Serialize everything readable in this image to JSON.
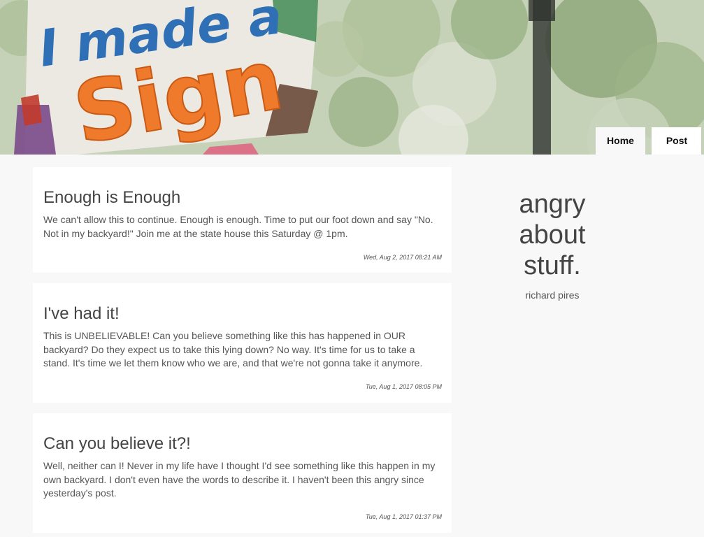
{
  "hero": {
    "sign_line1": "I made a",
    "sign_line2": "Sign"
  },
  "nav": {
    "items": [
      {
        "label": "Home"
      },
      {
        "label": "Post"
      }
    ]
  },
  "posts": [
    {
      "title": "Enough is Enough",
      "body": "We can't allow this to continue. Enough is enough. Time to put our foot down and say \"No. Not in my backyard!\" Join me at the state house this Saturday @ 1pm.",
      "timestamp": "Wed, Aug 2, 2017 08:21 AM"
    },
    {
      "title": "I've had it!",
      "body": "This is UNBELIEVABLE! Can you believe something like this has happened in OUR backyard? Do they expect us to take this lying down? No way. It's time for us to take a stand. It's time we let them know who we are, and that we're not gonna take it anymore.",
      "timestamp": "Tue, Aug 1, 2017 08:05 PM"
    },
    {
      "title": "Can you believe it?!",
      "body": "Well, neither can I! Never in my life have I thought I'd see something like this happen in my own backyard. I don't even have the words to describe it. I haven't been this angry since yesterday's post.",
      "timestamp": "Tue, Aug 1, 2017 01:37 PM"
    }
  ],
  "sidebar": {
    "title_line1": "angry",
    "title_line2": "about",
    "title_line3": "stuff.",
    "author": "richard pires"
  },
  "colors": {
    "page_bg": "#f8f8f8",
    "card_bg": "#ffffff",
    "text": "#444444"
  }
}
